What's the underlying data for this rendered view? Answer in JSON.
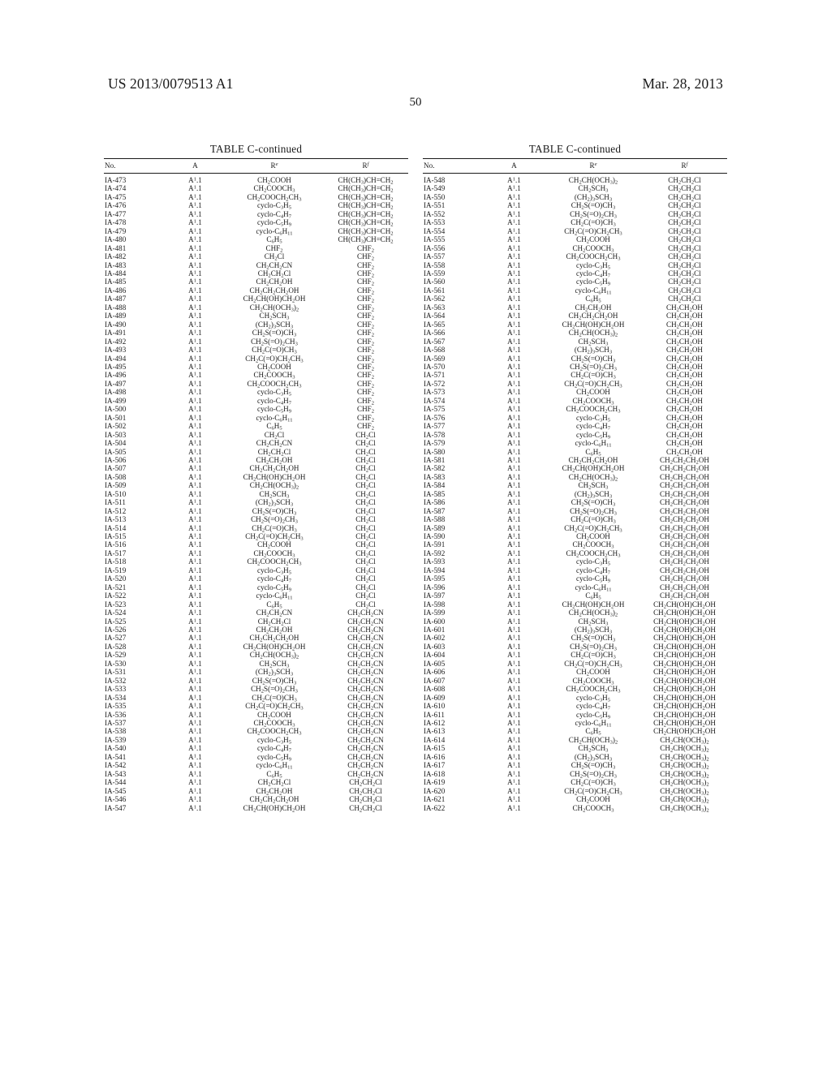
{
  "header": {
    "publication_number": "US 2013/0079513 A1",
    "publication_date": "Mar. 28, 2013",
    "page_number": "50"
  },
  "table_caption": "TABLE C-continued",
  "columns": [
    "No.",
    "A",
    "Re",
    "Rf"
  ],
  "column_html": [
    "No.",
    "A",
    "R<sup class=\"ital\">e</sup>",
    "R<sup class=\"ital\">f</sup>"
  ],
  "left_table": {
    "caption": "TABLE C-continued",
    "headers": [
      "No.",
      "A",
      "Re",
      "Rf"
    ],
    "rows": [
      [
        "IA-473",
        "A1.1",
        "CH2COOH",
        "CH(CH3)CH=CH2"
      ],
      [
        "IA-474",
        "A1.1",
        "CH2COOCH3",
        "CH(CH3)CH=CH2"
      ],
      [
        "IA-475",
        "A1.1",
        "CH2COOCH2CH3",
        "CH(CH3)CH=CH2"
      ],
      [
        "IA-476",
        "A1.1",
        "cyclo-C3H5",
        "CH(CH3)CH=CH2"
      ],
      [
        "IA-477",
        "A1.1",
        "cyclo-C4H7",
        "CH(CH3)CH=CH2"
      ],
      [
        "IA-478",
        "A1.1",
        "cyclo-C5H9",
        "CH(CH3)CH=CH2"
      ],
      [
        "IA-479",
        "A1.1",
        "cyclo-C6H11",
        "CH(CH3)CH=CH2"
      ],
      [
        "IA-480",
        "A1.1",
        "C6H5",
        "CH(CH3)CH=CH2"
      ],
      [
        "IA-481",
        "A1.1",
        "CHF2",
        "CHF2"
      ],
      [
        "IA-482",
        "A1.1",
        "CH2Cl",
        "CHF2"
      ],
      [
        "IA-483",
        "A1.1",
        "CH2CH2CN",
        "CHF2"
      ],
      [
        "IA-484",
        "A1.1",
        "CH2CH2Cl",
        "CHF2"
      ],
      [
        "IA-485",
        "A1.1",
        "CH2CH2OH",
        "CHF2"
      ],
      [
        "IA-486",
        "A1.1",
        "CH2CH2CH2OH",
        "CHF2"
      ],
      [
        "IA-487",
        "A1.1",
        "CH2CH(OH)CH2OH",
        "CHF2"
      ],
      [
        "IA-488",
        "A1.1",
        "CH2CH(OCH3)2",
        "CHF2"
      ],
      [
        "IA-489",
        "A1.1",
        "CH2SCH3",
        "CHF2"
      ],
      [
        "IA-490",
        "A1.1",
        "(CH2)3SCH3",
        "CHF2"
      ],
      [
        "IA-491",
        "A1.1",
        "CH2S(=O)CH3",
        "CHF2"
      ],
      [
        "IA-492",
        "A1.1",
        "CH2S(=O)2CH3",
        "CHF2"
      ],
      [
        "IA-493",
        "A1.1",
        "CH2C(=O)CH3",
        "CHF2"
      ],
      [
        "IA-494",
        "A1.1",
        "CH2C(=O)CH2CH3",
        "CHF2"
      ],
      [
        "IA-495",
        "A1.1",
        "CH2COOH",
        "CHF2"
      ],
      [
        "IA-496",
        "A1.1",
        "CH2COOCH3",
        "CHF2"
      ],
      [
        "IA-497",
        "A1.1",
        "CH2COOCH2CH3",
        "CHF2"
      ],
      [
        "IA-498",
        "A1.1",
        "cyclo-C3H5",
        "CHF2"
      ],
      [
        "IA-499",
        "A1.1",
        "cyclo-C4H7",
        "CHF2"
      ],
      [
        "IA-500",
        "A1.1",
        "cyclo-C5H9",
        "CHF2"
      ],
      [
        "IA-501",
        "A1.1",
        "cyclo-C6H11",
        "CHF2"
      ],
      [
        "IA-502",
        "A1.1",
        "C6H5",
        "CHF2"
      ],
      [
        "IA-503",
        "A1.1",
        "CH2Cl",
        "CH2Cl"
      ],
      [
        "IA-504",
        "A1.1",
        "CH2CH2CN",
        "CH2Cl"
      ],
      [
        "IA-505",
        "A1.1",
        "CH2CH2Cl",
        "CH2Cl"
      ],
      [
        "IA-506",
        "A1.1",
        "CH2CH2OH",
        "CH2Cl"
      ],
      [
        "IA-507",
        "A1.1",
        "CH2CH2CH2OH",
        "CH2Cl"
      ],
      [
        "IA-508",
        "A1.1",
        "CH2CH(OH)CH2OH",
        "CH2Cl"
      ],
      [
        "IA-509",
        "A1.1",
        "CH2CH(OCH3)2",
        "CH2Cl"
      ],
      [
        "IA-510",
        "A1.1",
        "CH2SCH3",
        "CH2Cl"
      ],
      [
        "IA-511",
        "A1.1",
        "(CH2)3SCH3",
        "CH2Cl"
      ],
      [
        "IA-512",
        "A1.1",
        "CH2S(=O)CH3",
        "CH2Cl"
      ],
      [
        "IA-513",
        "A1.1",
        "CH2S(=O)2CH3",
        "CH2Cl"
      ],
      [
        "IA-514",
        "A1.1",
        "CH2C(=O)CH3",
        "CH2Cl"
      ],
      [
        "IA-515",
        "A1.1",
        "CH2C(=O)CH2CH3",
        "CH2Cl"
      ],
      [
        "IA-516",
        "A1.1",
        "CH2COOH",
        "CH2Cl"
      ],
      [
        "IA-517",
        "A1.1",
        "CH2COOCH3",
        "CH2Cl"
      ],
      [
        "IA-518",
        "A1.1",
        "CH2COOCH2CH3",
        "CH2Cl"
      ],
      [
        "IA-519",
        "A1.1",
        "cyclo-C3H5",
        "CH2Cl"
      ],
      [
        "IA-520",
        "A1.1",
        "cyclo-C4H7",
        "CH2Cl"
      ],
      [
        "IA-521",
        "A1.1",
        "cyclo-C5H9",
        "CH2Cl"
      ],
      [
        "IA-522",
        "A1.1",
        "cyclo-C6H11",
        "CH2Cl"
      ],
      [
        "IA-523",
        "A1.1",
        "C6H5",
        "CH2Cl"
      ],
      [
        "IA-524",
        "A1.1",
        "CH2CH2CN",
        "CH2CH2CN"
      ],
      [
        "IA-525",
        "A1.1",
        "CH2CH2Cl",
        "CH2CH2CN"
      ],
      [
        "IA-526",
        "A1.1",
        "CH2CH2OH",
        "CH2CH2CN"
      ],
      [
        "IA-527",
        "A1.1",
        "CH2CH2CH2OH",
        "CH2CH2CN"
      ],
      [
        "IA-528",
        "A1.1",
        "CH2CH(OH)CH2OH",
        "CH2CH2CN"
      ],
      [
        "IA-529",
        "A1.1",
        "CH2CH(OCH3)2",
        "CH2CH2CN"
      ],
      [
        "IA-530",
        "A1.1",
        "CH2SCH3",
        "CH2CH2CN"
      ],
      [
        "IA-531",
        "A1.1",
        "(CH2)3SCH3",
        "CH2CH2CN"
      ],
      [
        "IA-532",
        "A1.1",
        "CH2S(=O)CH3",
        "CH2CH2CN"
      ],
      [
        "IA-533",
        "A1.1",
        "CH2S(=O)2CH3",
        "CH2CH2CN"
      ],
      [
        "IA-534",
        "A1.1",
        "CH2C(=O)CH3",
        "CH2CH2CN"
      ],
      [
        "IA-535",
        "A1.1",
        "CH2C(=O)CH2CH3",
        "CH2CH2CN"
      ],
      [
        "IA-536",
        "A1.1",
        "CH2COOH",
        "CH2CH2CN"
      ],
      [
        "IA-537",
        "A1.1",
        "CH2COOCH3",
        "CH2CH2CN"
      ],
      [
        "IA-538",
        "A1.1",
        "CH2COOCH2CH3",
        "CH2CH2CN"
      ],
      [
        "IA-539",
        "A1.1",
        "cyclo-C3H5",
        "CH2CH2CN"
      ],
      [
        "IA-540",
        "A1.1",
        "cyclo-C4H7",
        "CH2CH2CN"
      ],
      [
        "IA-541",
        "A1.1",
        "cyclo-C5H9",
        "CH2CH2CN"
      ],
      [
        "IA-542",
        "A1.1",
        "cyclo-C6H11",
        "CH2CH2CN"
      ],
      [
        "IA-543",
        "A1.1",
        "C6H5",
        "CH2CH2CN"
      ],
      [
        "IA-544",
        "A1.1",
        "CH2CH2Cl",
        "CH2CH2Cl"
      ],
      [
        "IA-545",
        "A1.1",
        "CH2CH2OH",
        "CH2CH2Cl"
      ],
      [
        "IA-546",
        "A1.1",
        "CH2CH2CH2OH",
        "CH2CH2Cl"
      ],
      [
        "IA-547",
        "A1.1",
        "CH2CH(OH)CH2OH",
        "CH2CH2Cl"
      ]
    ]
  },
  "right_table": {
    "caption": "TABLE C-continued",
    "headers": [
      "No.",
      "A",
      "Re",
      "Rf"
    ],
    "rows": [
      [
        "IA-548",
        "A1.1",
        "CH2CH(OCH3)2",
        "CH2CH2Cl"
      ],
      [
        "IA-549",
        "A1.1",
        "CH2SCH3",
        "CH2CH2Cl"
      ],
      [
        "IA-550",
        "A1.1",
        "(CH2)3SCH3",
        "CH2CH2Cl"
      ],
      [
        "IA-551",
        "A1.1",
        "CH2S(=O)CH3",
        "CH2CH2Cl"
      ],
      [
        "IA-552",
        "A1.1",
        "CH2S(=O)2CH3",
        "CH2CH2Cl"
      ],
      [
        "IA-553",
        "A1.1",
        "CH2C(=O)CH3",
        "CH2CH2Cl"
      ],
      [
        "IA-554",
        "A1.1",
        "CH2C(=O)CH2CH3",
        "CH2CH2Cl"
      ],
      [
        "IA-555",
        "A1.1",
        "CH2COOH",
        "CH2CH2Cl"
      ],
      [
        "IA-556",
        "A1.1",
        "CH2COOCH3",
        "CH2CH2Cl"
      ],
      [
        "IA-557",
        "A1.1",
        "CH2COOCH2CH3",
        "CH2CH2Cl"
      ],
      [
        "IA-558",
        "A1.1",
        "cyclo-C3H5",
        "CH2CH2Cl"
      ],
      [
        "IA-559",
        "A1.1",
        "cyclo-C4H7",
        "CH2CH2Cl"
      ],
      [
        "IA-560",
        "A1.1",
        "cyclo-C5H9",
        "CH2CH2Cl"
      ],
      [
        "IA-561",
        "A1.1",
        "cyclo-C6H11",
        "CH2CH2Cl"
      ],
      [
        "IA-562",
        "A1.1",
        "C6H5",
        "CH2CH2Cl"
      ],
      [
        "IA-563",
        "A1.1",
        "CH2CH2OH",
        "CH2CH2OH"
      ],
      [
        "IA-564",
        "A1.1",
        "CH2CH2CH2OH",
        "CH2CH2OH"
      ],
      [
        "IA-565",
        "A1.1",
        "CH2CH(OH)CH2OH",
        "CH2CH2OH"
      ],
      [
        "IA-566",
        "A1.1",
        "CH2CH(OCH3)2",
        "CH2CH2OH"
      ],
      [
        "IA-567",
        "A1.1",
        "CH2SCH3",
        "CH2CH2OH"
      ],
      [
        "IA-568",
        "A1.1",
        "(CH2)3SCH3",
        "CH2CH2OH"
      ],
      [
        "IA-569",
        "A1.1",
        "CH2S(=O)CH3",
        "CH2CH2OH"
      ],
      [
        "IA-570",
        "A1.1",
        "CH2S(=O)2CH3",
        "CH2CH2OH"
      ],
      [
        "IA-571",
        "A1.1",
        "CH2C(=O)CH3",
        "CH2CH2OH"
      ],
      [
        "IA-572",
        "A1.1",
        "CH2C(=O)CH2CH3",
        "CH2CH2OH"
      ],
      [
        "IA-573",
        "A1.1",
        "CH2COOH",
        "CH2CH2OH"
      ],
      [
        "IA-574",
        "A1.1",
        "CH2COOCH3",
        "CH2CH2OH"
      ],
      [
        "IA-575",
        "A1.1",
        "CH2COOCH2CH3",
        "CH2CH2OH"
      ],
      [
        "IA-576",
        "A1.1",
        "cyclo-C3H5",
        "CH2CH2OH"
      ],
      [
        "IA-577",
        "A1.1",
        "cyclo-C4H7",
        "CH2CH2OH"
      ],
      [
        "IA-578",
        "A1.1",
        "cyclo-C5H9",
        "CH2CH2OH"
      ],
      [
        "IA-579",
        "A1.1",
        "cyclo-C6H11",
        "CH2CH2OH"
      ],
      [
        "IA-580",
        "A1.1",
        "C6H5",
        "CH2CH2OH"
      ],
      [
        "IA-581",
        "A1.1",
        "CH2CH2CH2OH",
        "CH2CH2CH2OH"
      ],
      [
        "IA-582",
        "A1.1",
        "CH2CH(OH)CH2OH",
        "CH2CH2CH2OH"
      ],
      [
        "IA-583",
        "A1.1",
        "CH2CH(OCH3)2",
        "CH2CH2CH2OH"
      ],
      [
        "IA-584",
        "A1.1",
        "CH2SCH3",
        "CH2CH2CH2OH"
      ],
      [
        "IA-585",
        "A1.1",
        "(CH2)3SCH3",
        "CH2CH2CH2OH"
      ],
      [
        "IA-586",
        "A1.1",
        "CH2S(=O)CH3",
        "CH2CH2CH2OH"
      ],
      [
        "IA-587",
        "A1.1",
        "CH2S(=O)2CH3",
        "CH2CH2CH2OH"
      ],
      [
        "IA-588",
        "A1.1",
        "CH2C(=O)CH3",
        "CH2CH2CH2OH"
      ],
      [
        "IA-589",
        "A1.1",
        "CH2C(=O)CH2CH3",
        "CH2CH2CH2OH"
      ],
      [
        "IA-590",
        "A1.1",
        "CH2COOH",
        "CH2CH2CH2OH"
      ],
      [
        "IA-591",
        "A1.1",
        "CH2COOCH3",
        "CH2CH2CH2OH"
      ],
      [
        "IA-592",
        "A1.1",
        "CH2COOCH2CH3",
        "CH2CH2CH2OH"
      ],
      [
        "IA-593",
        "A1.1",
        "cyclo-C3H5",
        "CH2CH2CH2OH"
      ],
      [
        "IA-594",
        "A1.1",
        "cyclo-C4H7",
        "CH2CH2CH2OH"
      ],
      [
        "IA-595",
        "A1.1",
        "cyclo-C5H9",
        "CH2CH2CH2OH"
      ],
      [
        "IA-596",
        "A1.1",
        "cyclo-C6H11",
        "CH2CH2CH2OH"
      ],
      [
        "IA-597",
        "A1.1",
        "C6H5",
        "CH2CH2CH2OH"
      ],
      [
        "IA-598",
        "A1.1",
        "CH2CH(OH)CH2OH",
        "CH2CH(OH)CH2OH"
      ],
      [
        "IA-599",
        "A1.1",
        "CH2CH(OCH3)2",
        "CH2CH(OH)CH2OH"
      ],
      [
        "IA-600",
        "A1.1",
        "CH2SCH3",
        "CH2CH(OH)CH2OH"
      ],
      [
        "IA-601",
        "A1.1",
        "(CH2)3SCH3",
        "CH2CH(OH)CH2OH"
      ],
      [
        "IA-602",
        "A1.1",
        "CH2S(=O)CH3",
        "CH2CH(OH)CH2OH"
      ],
      [
        "IA-603",
        "A1.1",
        "CH2S(=O)2CH3",
        "CH2CH(OH)CH2OH"
      ],
      [
        "IA-604",
        "A1.1",
        "CH2C(=O)CH3",
        "CH2CH(OH)CH2OH"
      ],
      [
        "IA-605",
        "A1.1",
        "CH2C(=O)CH2CH3",
        "CH2CH(OH)CH2OH"
      ],
      [
        "IA-606",
        "A1.1",
        "CH2COOH",
        "CH2CH(OH)CH2OH"
      ],
      [
        "IA-607",
        "A1.1",
        "CH2COOCH3",
        "CH2CH(OH)CH2OH"
      ],
      [
        "IA-608",
        "A1.1",
        "CH2COOCH2CH3",
        "CH2CH(OH)CH2OH"
      ],
      [
        "IA-609",
        "A1.1",
        "cyclo-C3H5",
        "CH2CH(OH)CH2OH"
      ],
      [
        "IA-610",
        "A1.1",
        "cyclo-C4H7",
        "CH2CH(OH)CH2OH"
      ],
      [
        "IA-611",
        "A1.1",
        "cyclo-C5H9",
        "CH2CH(OH)CH2OH"
      ],
      [
        "IA-612",
        "A1.1",
        "cyclo-C6H11",
        "CH2CH(OH)CH2OH"
      ],
      [
        "IA-613",
        "A1.1",
        "C6H5",
        "CH2CH(OH)CH2OH"
      ],
      [
        "IA-614",
        "A1.1",
        "CH2CH(OCH3)2",
        "CH2CH(OCH3)2"
      ],
      [
        "IA-615",
        "A1.1",
        "CH2SCH3",
        "CH2CH(OCH3)2"
      ],
      [
        "IA-616",
        "A1.1",
        "(CH2)3SCH3",
        "CH2CH(OCH3)2"
      ],
      [
        "IA-617",
        "A1.1",
        "CH2S(=O)CH3",
        "CH2CH(OCH3)2"
      ],
      [
        "IA-618",
        "A1.1",
        "CH2S(=O)2CH3",
        "CH2CH(OCH3)2"
      ],
      [
        "IA-619",
        "A1.1",
        "CH2C(=O)CH3",
        "CH2CH(OCH3)2"
      ],
      [
        "IA-620",
        "A1.1",
        "CH2C(=O)CH2CH3",
        "CH2CH(OCH3)2"
      ],
      [
        "IA-621",
        "A1.1",
        "CH2COOH",
        "CH2CH(OCH3)2"
      ],
      [
        "IA-622",
        "A1.1",
        "CH2COOCH3",
        "CH2CH(OCH3)2"
      ]
    ]
  }
}
